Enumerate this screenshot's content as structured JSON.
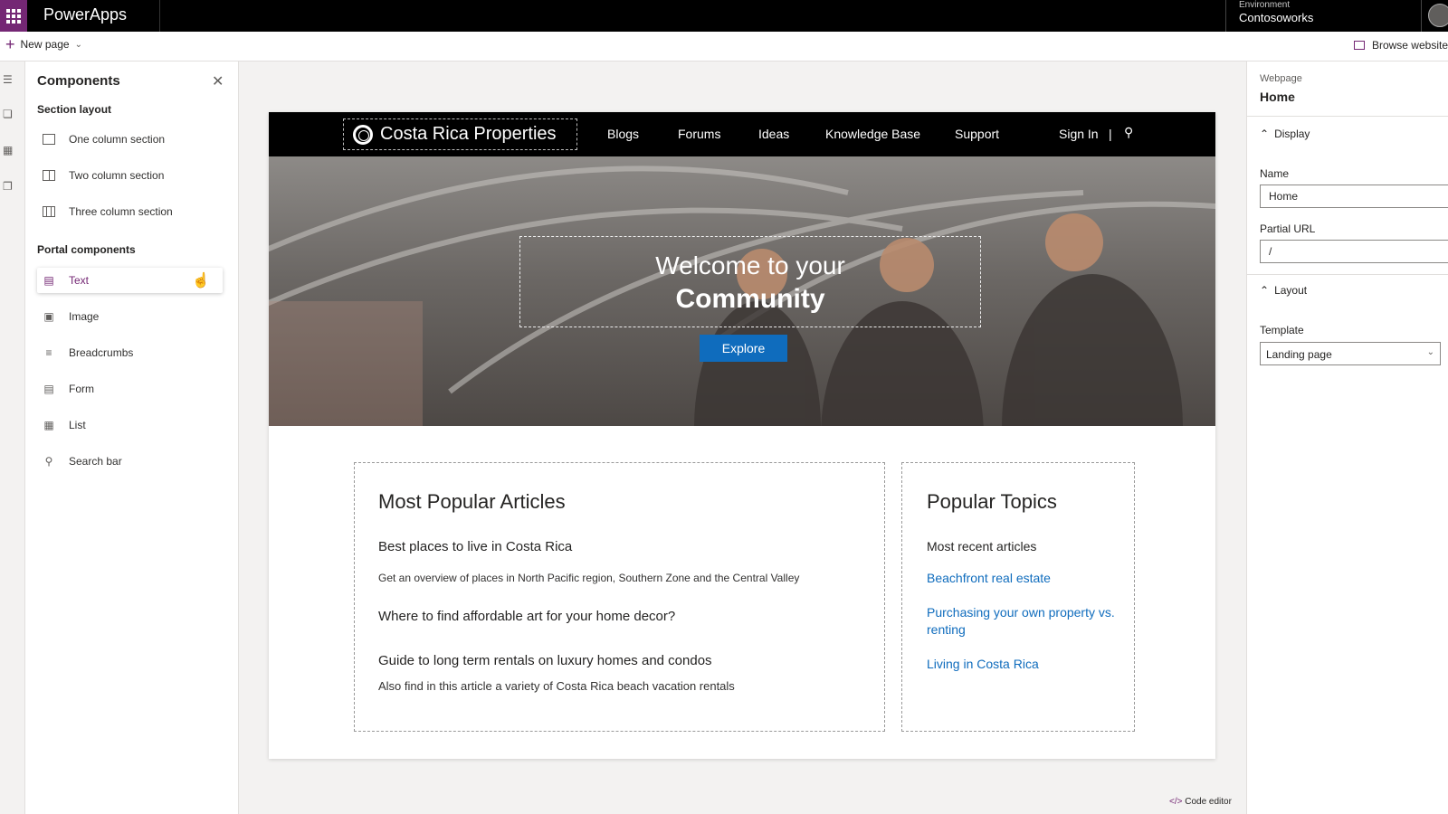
{
  "topbar": {
    "app_name": "PowerApps",
    "env_label": "Environment",
    "env_name": "Contosoworks"
  },
  "cmdbar": {
    "new_page": "New page",
    "browse_website": "Browse website"
  },
  "components": {
    "title": "Components",
    "section_layout": "Section layout",
    "layouts": [
      "One column section",
      "Two column section",
      "Three column section"
    ],
    "portal_components": "Portal components",
    "items": [
      "Text",
      "Image",
      "Breadcrumbs",
      "Form",
      "List",
      "Search bar"
    ]
  },
  "site": {
    "brand": "Costa Rica Properties",
    "nav": [
      "Blogs",
      "Forums",
      "Ideas",
      "Knowledge Base",
      "Support"
    ],
    "sign_in": "Sign In",
    "hero_line1": "Welcome to your",
    "hero_line2": "Community",
    "explore": "Explore",
    "articles_title": "Most Popular Articles",
    "articles": [
      {
        "title": "Best places to live in Costa Rica",
        "desc": "Get an overview of places in North Pacific region, Southern Zone and the Central Valley"
      },
      {
        "title": "Where to find affordable art for your home decor?",
        "desc": ""
      },
      {
        "title": "Guide to long term rentals on luxury homes and condos",
        "desc": "Also find in this article  a variety of Costa Rica beach vacation rentals"
      }
    ],
    "topics_title": "Popular Topics",
    "topics_subtitle": "Most recent articles",
    "topics": [
      "Beachfront real estate",
      "Purchasing your own property vs. renting",
      "Living in Costa Rica"
    ]
  },
  "properties": {
    "type_label": "Webpage",
    "title": "Home",
    "display_section": "Display",
    "name_label": "Name",
    "name_value": "Home",
    "url_label": "Partial URL",
    "url_value": "/",
    "layout_section": "Layout",
    "template_label": "Template",
    "template_value": "Landing page"
  },
  "footer": {
    "code_editor": "Code editor"
  },
  "colors": {
    "brand": "#742774",
    "accent": "#0f6cbd"
  }
}
